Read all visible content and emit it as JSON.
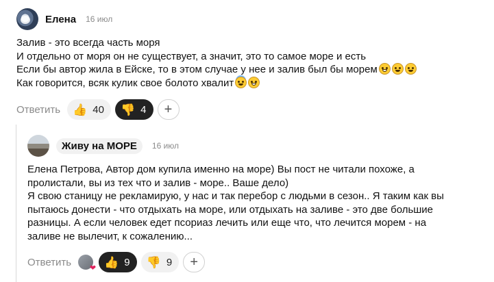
{
  "comment1": {
    "author": "Елена",
    "date": "16 июл",
    "lines": [
      "Залив - это всегда часть моря",
      "И отдельно от моря он не существует, а значит, это то самое море и есть",
      "Если бы автор жила в Ейске, то в этом случае у нее и залив был бы морем",
      "Как говорится, всяк кулик свое болото хвалит"
    ],
    "actions": {
      "reply_label": "Ответить",
      "likes": "40",
      "dislikes": "4",
      "plus_symbol": "+"
    }
  },
  "comment2": {
    "author": "Живу на МОРЕ",
    "date": "16 июл",
    "lines": [
      "Елена Петрова, Автор дом купила именно на море) Вы пост не читали похоже, а",
      "пролистали, вы из тех что и залив - море.. Ваше дело)",
      "Я свою станицу не рекламирую, у нас и так перебор с людьми в сезон.. Я таким как вы",
      "пытаюсь донести - что отдыхать на море, или отдыхать на заливе - это две большие",
      "разницы. А если человек едет псориаз лечить или еще что, что лечится морем - на",
      "заливе не вылечит, к сожалению..."
    ],
    "actions": {
      "reply_label": "Ответить",
      "likes": "9",
      "dislikes": "9",
      "plus_symbol": "+"
    }
  },
  "icons": {
    "like": "👍",
    "dislike": "👎"
  },
  "colors": {
    "dislike_active_bg": "#222222",
    "pill_bg": "#f1f1f1",
    "muted_text": "#8a8a8a"
  }
}
